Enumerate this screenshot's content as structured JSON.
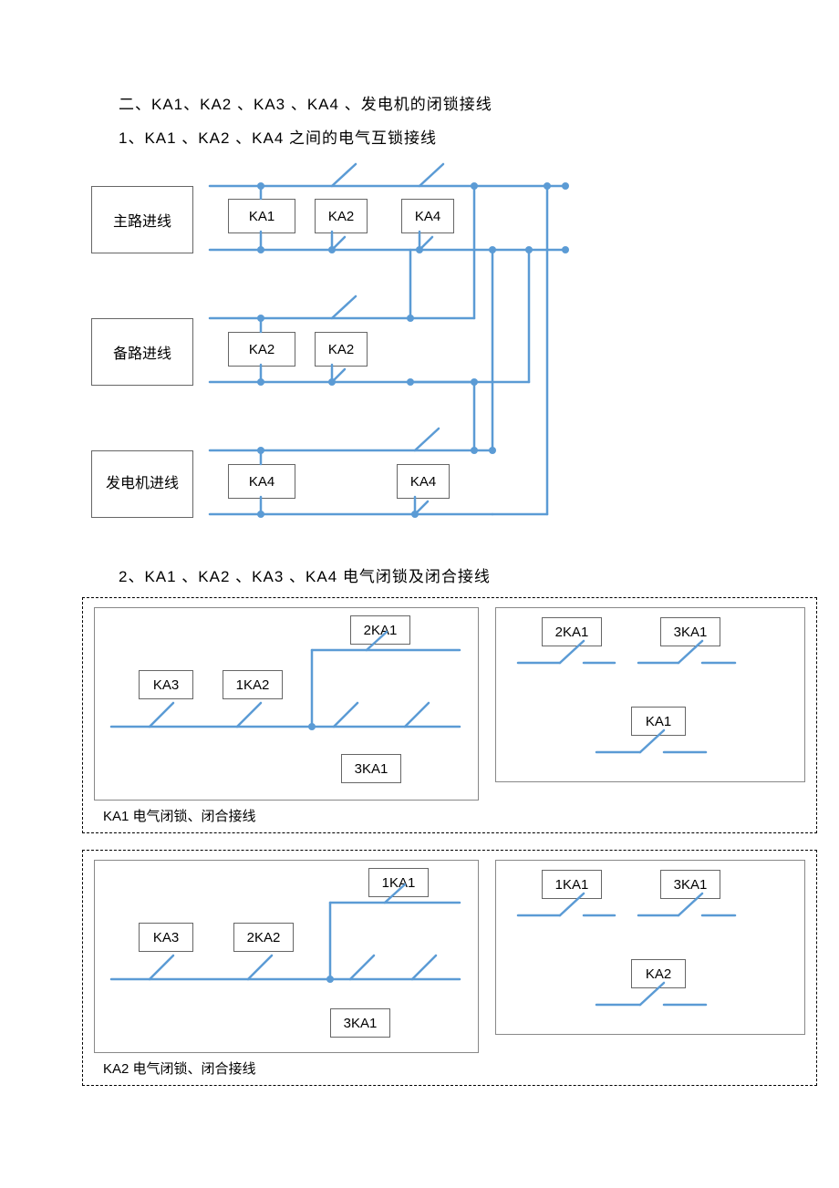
{
  "headings": {
    "h1": "二、KA1、KA2 、KA3 、KA4 、发电机的闭锁接线",
    "h2": "1、KA1 、KA2 、KA4  之间的电气互锁接线",
    "h3": "2、KA1 、KA2 、KA3 、KA4  电气闭锁及闭合接线"
  },
  "rows": {
    "main": "主路进线",
    "backup": "备路进线",
    "gen": "发电机进线"
  },
  "relays": {
    "r1_1": "KA1",
    "r1_2": "KA2",
    "r1_3": "KA4",
    "r2_1": "KA2",
    "r2_2": "KA2",
    "r3_1": "KA4",
    "r3_2": "KA4"
  },
  "block_a": {
    "top": "2KA1",
    "mid_l": "KA3",
    "mid_r": "1KA2",
    "bot": "3KA1",
    "right_t1": "2KA1",
    "right_t2": "3KA1",
    "right_b": "KA1",
    "caption": "KA1  电气闭锁、闭合接线"
  },
  "block_b": {
    "top": "1KA1",
    "mid_l": "KA3",
    "mid_r": "2KA2",
    "bot": "3KA1",
    "right_t1": "1KA1",
    "right_t2": "3KA1",
    "right_b": "KA2",
    "caption": "KA2  电气闭锁、闭合接线"
  }
}
